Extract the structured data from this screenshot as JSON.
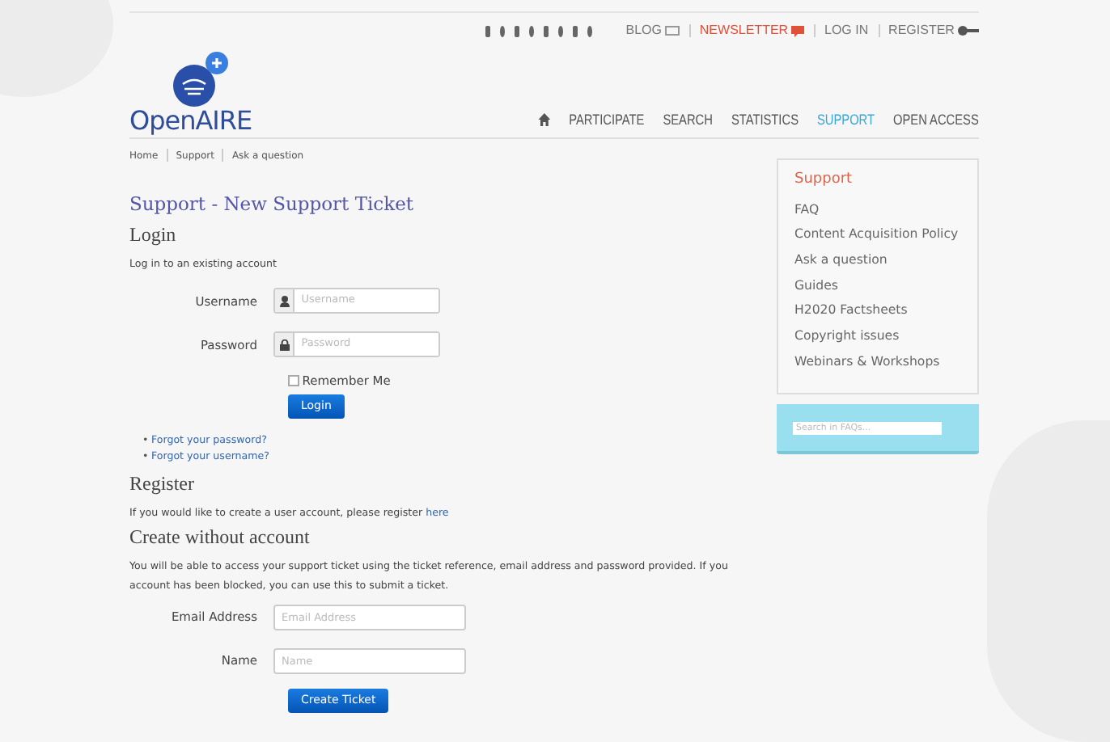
{
  "top_links": [
    {
      "label": "BLOG",
      "kind": "blog"
    },
    {
      "label": "NEWSLETTER",
      "kind": "newsletter"
    },
    {
      "label": "LOG IN",
      "kind": "plain"
    },
    {
      "label": "REGISTER",
      "kind": "register"
    }
  ],
  "logo": {
    "text": "OpenAIRE"
  },
  "nav": [
    {
      "label": "PARTICIPATE",
      "selected": false
    },
    {
      "label": "SEARCH",
      "selected": false
    },
    {
      "label": "STATISTICS",
      "selected": false
    },
    {
      "label": "SUPPORT",
      "selected": true
    },
    {
      "label": "OPEN ACCESS",
      "selected": false
    }
  ],
  "breadcrumb": [
    "Home",
    "Support",
    "Ask a question"
  ],
  "page_title": "Support - New Support Ticket",
  "login": {
    "heading": "Login",
    "intro": "Log in to an existing account",
    "fields": [
      {
        "label": "Username",
        "placeholder": "Username",
        "kind": "user"
      },
      {
        "label": "Password",
        "placeholder": "Password",
        "kind": "lock"
      }
    ],
    "remember": {
      "label": "Remember Me",
      "checked": false
    },
    "button": "Login",
    "links": [
      {
        "bullet": "•",
        "label": "Forgot your password?"
      },
      {
        "bullet": "•",
        "label": "Forgot your username?"
      }
    ]
  },
  "register": {
    "heading": "Register",
    "text": "If you would like to create a user account, please register ",
    "link": "here"
  },
  "guest": {
    "heading": "Create without account",
    "text": "You will be able to access your support ticket using the ticket reference, email address and password provided. If you account has been blocked, you can use this to submit a ticket.",
    "fields": [
      {
        "label": "Email Address",
        "placeholder": "Email Address"
      },
      {
        "label": "Name",
        "placeholder": "Name"
      }
    ],
    "button": "Create Ticket"
  },
  "sidebar": {
    "heading": "Support",
    "items": [
      "FAQ",
      "Content Acquisition Policy",
      "Ask a question",
      "Guides",
      "H2020 Factsheets",
      "Copyright issues",
      "Webinars & Workshops"
    ]
  },
  "faq_search": {
    "placeholder": "Search in FAQs..."
  }
}
